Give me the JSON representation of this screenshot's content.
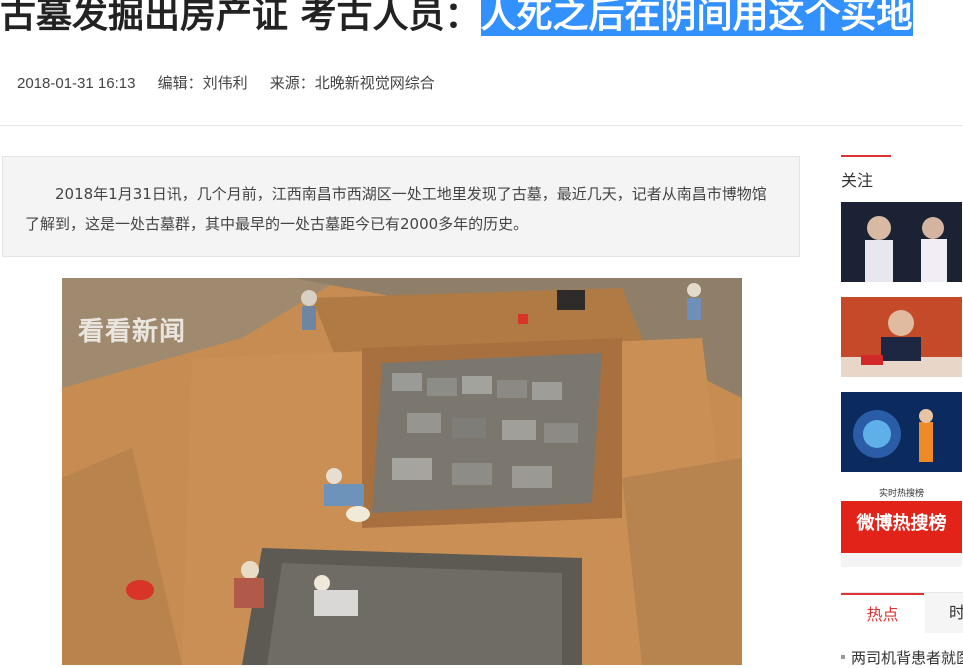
{
  "article": {
    "title_plain": "古墓发掘出房产证 考古人员：",
    "title_selected": "人死之后在阴间用这个买地",
    "date": "2018-01-31 16:13",
    "editor": "编辑：刘伟利",
    "source": "来源：北晚新视觉网综合",
    "summary": "2018年1月31日讯，几个月前，江西南昌市西湖区一处工地里发现了古墓，最近几天，记者从南昌市博物馆了解到，这是一处古墓群，其中最早的一处古墓距今已有2000多年的历史。",
    "image_watermark": "看看新闻"
  },
  "sidebar": {
    "follow_title": "关注",
    "thumb4_caption_top": "实时热搜榜",
    "thumb4_caption_main": "微博热搜榜",
    "tabs": {
      "active": "热点",
      "other": "时"
    },
    "hot_item": "两司机背患者就医"
  },
  "colors": {
    "selection": "#3390ff",
    "accent": "#dd3333",
    "soil": "#c58a4e"
  }
}
